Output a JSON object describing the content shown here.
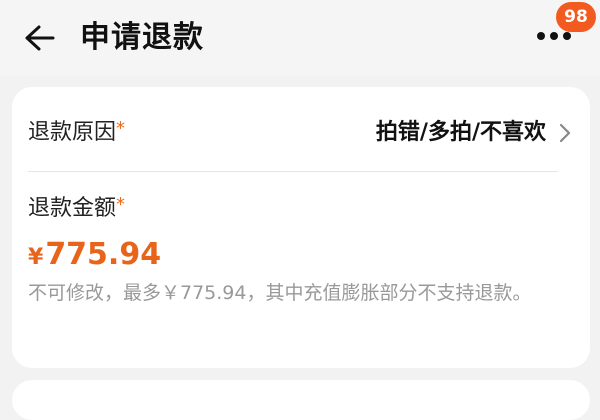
{
  "header": {
    "title": "申请退款",
    "notification_count": "98"
  },
  "form": {
    "reason": {
      "label": "退款原因",
      "required_mark": "*",
      "value": "拍错/多拍/不喜欢"
    },
    "amount": {
      "label": "退款金额",
      "required_mark": "*",
      "currency": "¥",
      "value": "775.94",
      "note": "不可修改，最多￥775.94，其中充值膨胀部分不支持退款。"
    }
  },
  "colors": {
    "accent": "#e8641a",
    "badge": "#f25a1f"
  },
  "icons": [
    "arrow-left-icon",
    "more-dots-icon",
    "chevron-right-icon"
  ]
}
